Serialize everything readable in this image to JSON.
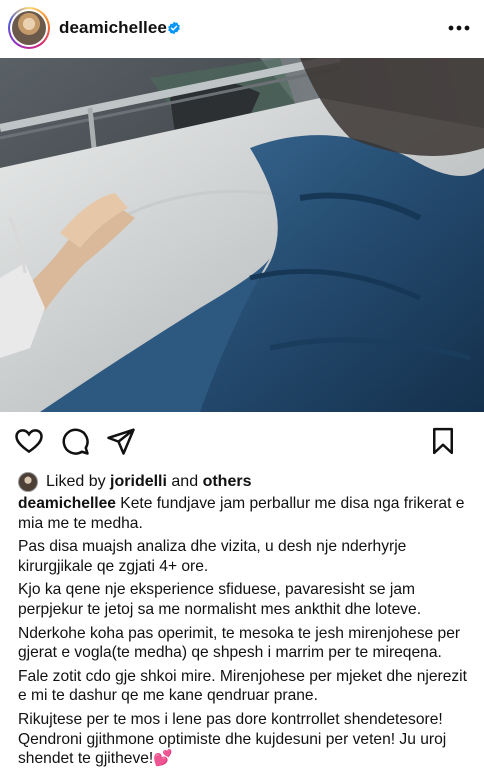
{
  "post": {
    "username": "deamichellee",
    "verified": true,
    "icons": {
      "avatar": "profile-avatar",
      "verified": "verified-badge-icon",
      "more": "more-options-icon",
      "like": "heart-icon",
      "comment": "comment-icon",
      "share": "send-icon",
      "save": "bookmark-icon"
    },
    "photo_alt": "hospital bed with blue blanket and IV-lined arm"
  },
  "likes": {
    "prefix": "Liked by",
    "user": "joridelli",
    "joiner": "and",
    "others": "others"
  },
  "caption": {
    "username": "deamichellee",
    "paragraphs": [
      "Kete fundjave jam perballur me disa nga frikerat e mia me te medha.",
      "Pas disa muajsh analiza dhe vizita, u desh nje nderhyrje kirurgjikale qe zgjati 4+ ore.",
      "Kjo ka qene nje eksperience sfiduese, pavaresisht se jam perpjekur te jetoj sa me normalisht mes ankthit dhe loteve.",
      "Nderkohe koha pas operimit, te mesoka te jesh mirenjohese per gjerat e vogla(te medha) qe shpesh i marrim per te mireqena.",
      "Fale zotit cdo gje shkoi mire. Mirenjohese per mjeket dhe njerezit e mi te dashur qe me kane qendruar prane.",
      "Rikujtese per te mos i lene pas dore kontrrollet shendetesore! Qendroni gjithmone optimiste dhe kujdesuni per veten! Ju uroj shendet te gjitheve!💕"
    ]
  },
  "colors": {
    "verified": "#0095f6",
    "text": "#111111",
    "blanket": "#244a6e"
  }
}
